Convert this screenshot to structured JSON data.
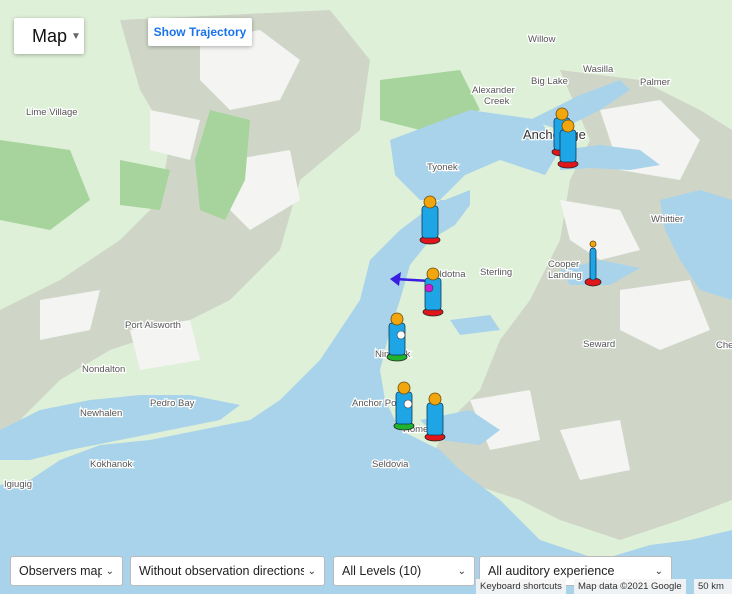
{
  "map_type": {
    "label": "Map"
  },
  "trajectory_button": {
    "label": "Show Trajectory"
  },
  "filters": {
    "observers": "Observers map",
    "directions": "Without observation directions",
    "levels": "All Levels (10)",
    "experience": "All auditory experience"
  },
  "attribution": {
    "shortcuts": "Keyboard shortcuts",
    "data": "Map data ©2021 Google",
    "scale": "50 km"
  },
  "places": {
    "willow": "Willow",
    "wasilla": "Wasilla",
    "palmer": "Palmer",
    "big_lake": "Big Lake",
    "alexander_creek": "Alexander\nCreek",
    "anchorage": "Anchorage",
    "lime_village": "Lime Village",
    "tyonek": "Tyonek",
    "whittier": "Whittier",
    "soldotna": "Soldotna",
    "sterling": "Sterling",
    "cooper_landing": "Cooper\nLanding",
    "port_alsworth": "Port Alsworth",
    "seward": "Seward",
    "nondalton": "Nondalton",
    "ninilchik": "Ninilchik",
    "pedro_bay": "Pedro Bay",
    "anchor_point": "Anchor Point",
    "newhalen": "Newhalen",
    "homer": "Homer",
    "kokhanok": "Kokhanok",
    "seldovia": "Seldovia",
    "igiugig": "Igiugig",
    "chenega": "Che"
  },
  "colors": {
    "water": "#a9d3ea",
    "land": "#dff0d8",
    "mountain": "#cdd5c5",
    "snow": "#f4f4f2",
    "forest": "#9ecf95",
    "figure_body": "#1ea5e6",
    "figure_head": "#f2a60e",
    "base_red": "#e0161b",
    "base_green": "#1fb32e",
    "arrow": "#3a1fe0"
  },
  "markers": [
    {
      "name": "observer-anchorage-1",
      "base": "red",
      "dot": "none"
    },
    {
      "name": "observer-anchorage-2",
      "base": "red",
      "dot": "none"
    },
    {
      "name": "observer-tyonek",
      "base": "red",
      "dot": "none"
    },
    {
      "name": "observer-soldotna",
      "base": "red",
      "dot": "magenta"
    },
    {
      "name": "observer-cooper-landing",
      "base": "red",
      "dot": "none"
    },
    {
      "name": "observer-ninilchik",
      "base": "green",
      "dot": "white"
    },
    {
      "name": "observer-anchor-point",
      "base": "green",
      "dot": "white"
    },
    {
      "name": "observer-homer",
      "base": "red",
      "dot": "none"
    }
  ]
}
